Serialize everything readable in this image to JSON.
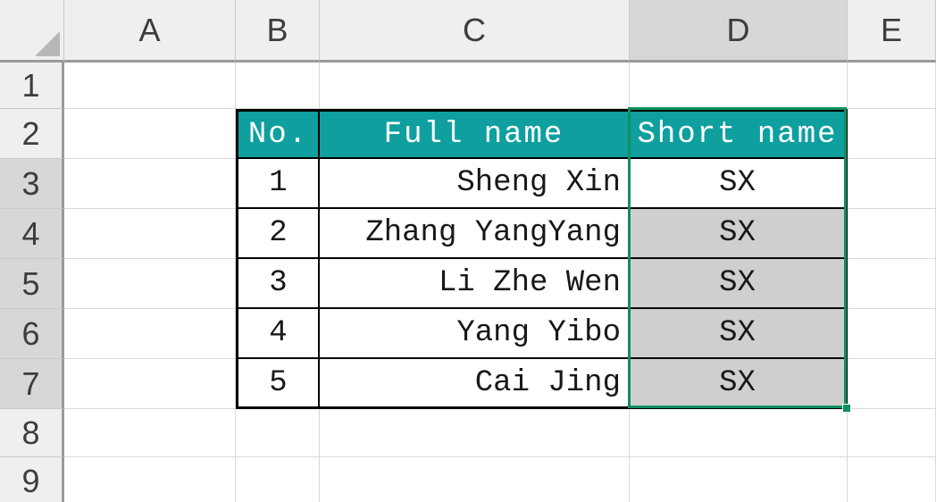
{
  "columns": {
    "labels": [
      "A",
      "B",
      "C",
      "D",
      "E"
    ],
    "widths": [
      192,
      94,
      347,
      244,
      99
    ],
    "selected_index": 3
  },
  "rows": {
    "labels": [
      "1",
      "2",
      "3",
      "4",
      "5",
      "6",
      "7",
      "8",
      "9"
    ],
    "heights": [
      52,
      56,
      56,
      56,
      56,
      56,
      56,
      54,
      54
    ],
    "selected_from": 2,
    "selected_to": 6
  },
  "colors": {
    "header_fill": "#0f9f9f",
    "selection_border": "#0f8f5f",
    "flash_fill": "#cfcfcf"
  },
  "table": {
    "start_col": 1,
    "start_row": 1,
    "headers": {
      "no": "No.",
      "full": "Full name",
      "short": "Short name"
    },
    "rows": [
      {
        "no": "1",
        "full": "Sheng Xin",
        "short": "SX",
        "flash": false
      },
      {
        "no": "2",
        "full": "Zhang YangYang",
        "short": "SX",
        "flash": true
      },
      {
        "no": "3",
        "full": "Li Zhe Wen",
        "short": "SX",
        "flash": true
      },
      {
        "no": "4",
        "full": "Yang Yibo",
        "short": "SX",
        "flash": true
      },
      {
        "no": "5",
        "full": "Cai Jing",
        "short": "SX",
        "flash": true
      }
    ]
  },
  "selection": {
    "col": 3,
    "row_from": 1,
    "row_to": 6,
    "active_row": 2
  },
  "chart_data": {
    "type": "table",
    "title": "",
    "columns": [
      "No.",
      "Full name",
      "Short name"
    ],
    "rows": [
      [
        "1",
        "Sheng Xin",
        "SX"
      ],
      [
        "2",
        "Zhang YangYang",
        "SX"
      ],
      [
        "3",
        "Li Zhe Wen",
        "SX"
      ],
      [
        "4",
        "Yang Yibo",
        "SX"
      ],
      [
        "5",
        "Cai Jing",
        "SX"
      ]
    ]
  }
}
